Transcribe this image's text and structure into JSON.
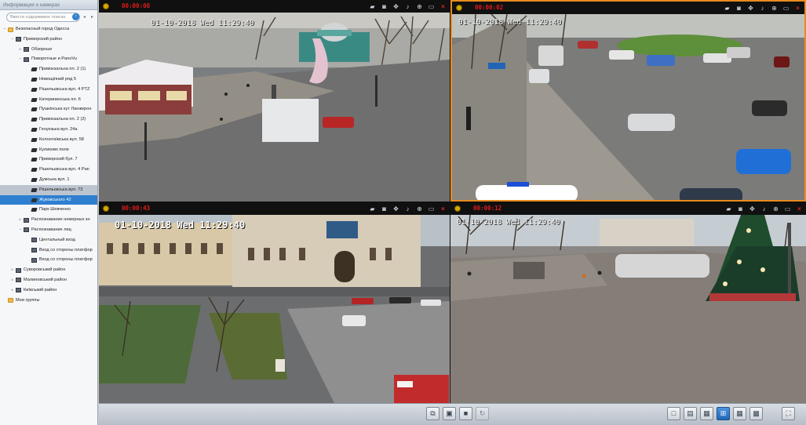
{
  "panel": {
    "title": "Информация о камерах",
    "search_placeholder": "Ввести содержимое поиска",
    "search_go": "›",
    "nav_prev": "◂",
    "nav_next": "▸"
  },
  "tree": [
    {
      "label": "Безопасный город Одесса",
      "level": 0,
      "icon": "folder",
      "exp": "−"
    },
    {
      "label": "Приморский район",
      "level": 1,
      "icon": "dir",
      "exp": "−"
    },
    {
      "label": "Обзорные",
      "level": 2,
      "icon": "dir",
      "exp": "▹"
    },
    {
      "label": "Поворотные и PanoVu",
      "level": 2,
      "icon": "dir",
      "exp": "−"
    },
    {
      "label": "Привокзальна пл. 2 (1)",
      "level": 3,
      "icon": "cam"
    },
    {
      "label": "Новощіпний ряд  5",
      "level": 3,
      "icon": "cam"
    },
    {
      "label": "Рішельєвська вул. 4 PTZ",
      "level": 3,
      "icon": "cam"
    },
    {
      "label": "Катерининська пл. 6",
      "level": 3,
      "icon": "cam"
    },
    {
      "label": "Пушкінська кут Ланжерон",
      "level": 3,
      "icon": "cam"
    },
    {
      "label": "Привокзальна пл. 2 (2)",
      "level": 3,
      "icon": "cam"
    },
    {
      "label": "Генуезька вул. 24а",
      "level": 3,
      "icon": "cam"
    },
    {
      "label": "Колонтаївська вул. 58",
      "level": 3,
      "icon": "cam"
    },
    {
      "label": "Куликово поле",
      "level": 3,
      "icon": "cam"
    },
    {
      "label": "Приморский бул. 7",
      "level": 3,
      "icon": "cam"
    },
    {
      "label": "Рішельєвська вул. 4 Pan",
      "level": 3,
      "icon": "cam"
    },
    {
      "label": "Думська вул. 1",
      "level": 3,
      "icon": "cam"
    },
    {
      "label": "Рішельєвська вул. 73",
      "level": 3,
      "icon": "cam",
      "state": "sel"
    },
    {
      "label": "Жуковського 42",
      "level": 3,
      "icon": "cam",
      "state": "hl"
    },
    {
      "label": "Парк Шевченко",
      "level": 3,
      "icon": "cam"
    },
    {
      "label": "Распознавание номерных зн",
      "level": 2,
      "icon": "dir",
      "exp": "▹"
    },
    {
      "label": "Распознавание лиц",
      "level": 2,
      "icon": "dir",
      "exp": "−"
    },
    {
      "label": "Центальный вход",
      "level": 3,
      "icon": "dir"
    },
    {
      "label": "Вход со стороны платфор",
      "level": 3,
      "icon": "dir"
    },
    {
      "label": "Вход со стороны платфор",
      "level": 3,
      "icon": "dir"
    },
    {
      "label": "Суворовський район",
      "level": 1,
      "icon": "dir",
      "exp": "▹"
    },
    {
      "label": "Малиновський район",
      "level": 1,
      "icon": "dir",
      "exp": "▹"
    },
    {
      "label": "Київський район",
      "level": 1,
      "icon": "dir",
      "exp": "▹"
    },
    {
      "label": "Мои группы",
      "level": 0,
      "icon": "folder"
    }
  ],
  "cells": [
    {
      "time": "00:00:08",
      "osd": "01-10-2018 Wed 11:29:40",
      "active": false
    },
    {
      "time": "00:00:02",
      "osd": "01-10-2018 Wed 11:29:40",
      "active": true
    },
    {
      "time": "00:00:43",
      "osd": "01-10-2018 Wed 11:29:40",
      "active": false
    },
    {
      "time": "00:00:12",
      "osd": "01-10-2018 Wed 11:29:40",
      "active": false
    }
  ],
  "tool_icons": [
    "record-icon",
    "snapshot-icon",
    "ptz-icon",
    "audio-icon",
    "zoom-icon",
    "stream-icon",
    "close-icon"
  ],
  "bottom": {
    "left_buttons": [
      "tile-windows-icon",
      "capture-icon",
      "record-all-icon",
      "refresh-icon"
    ],
    "layout_buttons": [
      "layout-1-icon",
      "layout-2-icon",
      "layout-3-icon",
      "layout-4-icon",
      "layout-9-icon",
      "layout-16-icon",
      "fullscreen-icon"
    ],
    "selected_layout": "layout-4-icon"
  },
  "colors": {
    "rec_time": "#e01b1b",
    "active_border": "#e88b1f",
    "selection": "#2f7fd0"
  }
}
